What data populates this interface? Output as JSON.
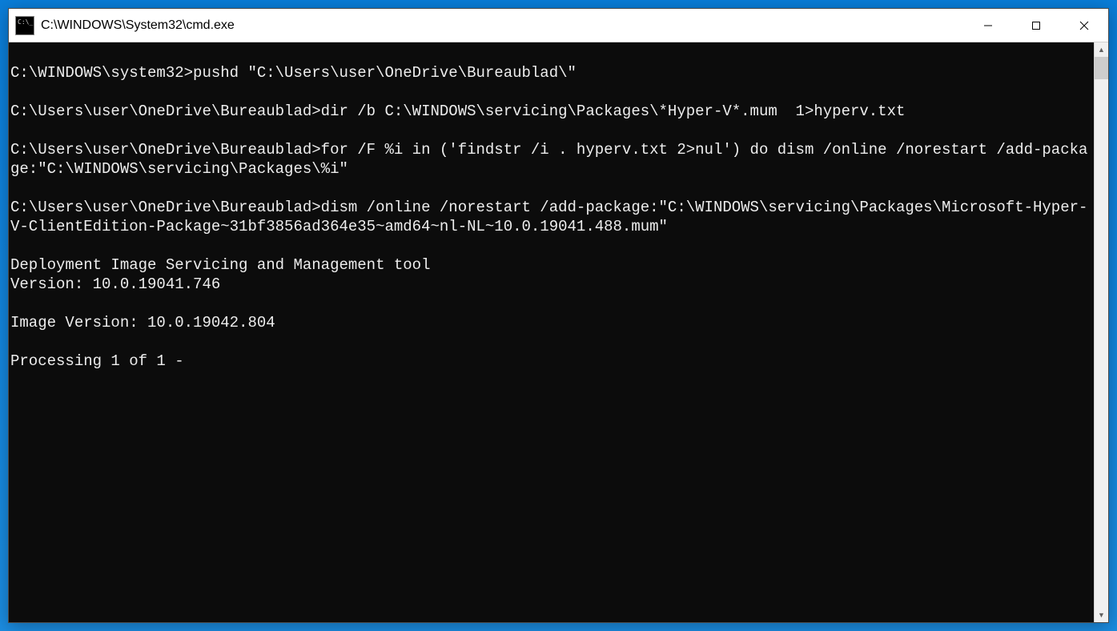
{
  "window": {
    "title": "C:\\WINDOWS\\System32\\cmd.exe"
  },
  "terminal": {
    "lines": [
      "",
      "C:\\WINDOWS\\system32>pushd \"C:\\Users\\user\\OneDrive\\Bureaublad\\\"",
      "",
      "C:\\Users\\user\\OneDrive\\Bureaublad>dir /b C:\\WINDOWS\\servicing\\Packages\\*Hyper-V*.mum  1>hyperv.txt",
      "",
      "C:\\Users\\user\\OneDrive\\Bureaublad>for /F %i in ('findstr /i . hyperv.txt 2>nul') do dism /online /norestart /add-package:\"C:\\WINDOWS\\servicing\\Packages\\%i\"",
      "",
      "C:\\Users\\user\\OneDrive\\Bureaublad>dism /online /norestart /add-package:\"C:\\WINDOWS\\servicing\\Packages\\Microsoft-Hyper-V-ClientEdition-Package~31bf3856ad364e35~amd64~nl-NL~10.0.19041.488.mum\"",
      "",
      "Deployment Image Servicing and Management tool",
      "Version: 10.0.19041.746",
      "",
      "Image Version: 10.0.19042.804",
      "",
      "Processing 1 of 1 -"
    ]
  }
}
